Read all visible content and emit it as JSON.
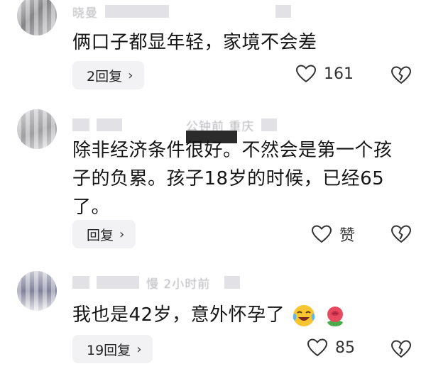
{
  "comments": [
    {
      "username": "晓曼",
      "text": "俩口子都显年轻，家境不会差",
      "reply_label": "2回复",
      "like_count": "161"
    },
    {
      "username": "",
      "meta_partial": "公钟前 重庆",
      "text": "除非经济条件很好。不然会是第一个孩子的负累。孩子18岁的时候，已经65了。",
      "reply_label": "回复",
      "like_count": "赞"
    },
    {
      "username": "",
      "meta_partial": "慢 2小时前",
      "text": "我也是42岁，意外怀孕了",
      "reply_label": "19回复",
      "like_count": "85"
    }
  ],
  "icons": {
    "like": "heart-outline-icon",
    "dislike": "broken-heart-icon",
    "reply_chevron": "chevron-right-icon",
    "emoji_1": "laughing-crying-face-icon",
    "emoji_2": "rose-icon"
  },
  "colors": {
    "reply_button_bg": "#f2f2f4",
    "text": "#151515",
    "icon": "#333333"
  }
}
